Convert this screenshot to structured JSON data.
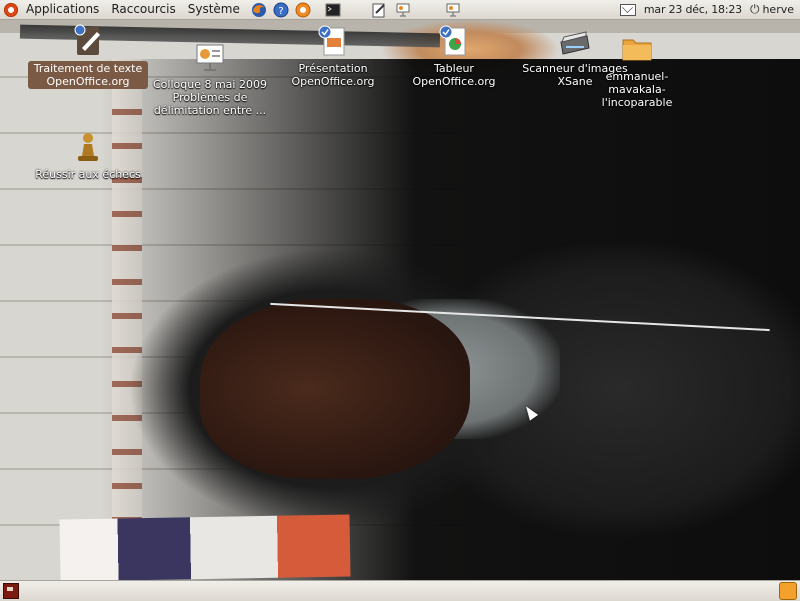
{
  "top_panel": {
    "menus": [
      {
        "label": "Applications"
      },
      {
        "label": "Raccourcis"
      },
      {
        "label": "Système"
      }
    ],
    "launchers": [
      "firefox-icon",
      "help-icon",
      "ubuntu-one-icon",
      "terminal-icon"
    ],
    "extra_launchers": [
      "notes-icon",
      "presentation-icon",
      "presentation-icon"
    ],
    "clock": "mar 23 déc, 18:23",
    "user": "herve",
    "icons": {
      "mail": "mail-icon",
      "power": "power-icon"
    }
  },
  "desktop": {
    "icons": [
      {
        "label": "Traitement de texte OpenOffice.org",
        "icon": "writer-icon",
        "selected": true
      },
      {
        "label": "Colloque 8 mai 2009 Problèmes de délimitation entre ...",
        "icon": "presentation-file-icon",
        "selected": false
      },
      {
        "label": "Présentation OpenOffice.org",
        "icon": "impress-icon",
        "selected": false
      },
      {
        "label": "Tableur OpenOffice.org",
        "icon": "calc-icon",
        "selected": false
      },
      {
        "label": "Scanneur d'images XSane",
        "icon": "scanner-icon",
        "selected": false
      },
      {
        "label": "emmanuel-mavakala-l'incoparable",
        "icon": "folder-icon",
        "selected": false
      },
      {
        "label": "Réussir aux échecs",
        "icon": "chess-icon",
        "selected": false
      }
    ]
  },
  "bottom_panel": {
    "show_desktop": "show-desktop-icon",
    "trash": "trash-icon"
  },
  "colors": {
    "panel": "#e8e5de",
    "selection": "#7b5a45",
    "ubuntu_orange": "#dd4814"
  }
}
